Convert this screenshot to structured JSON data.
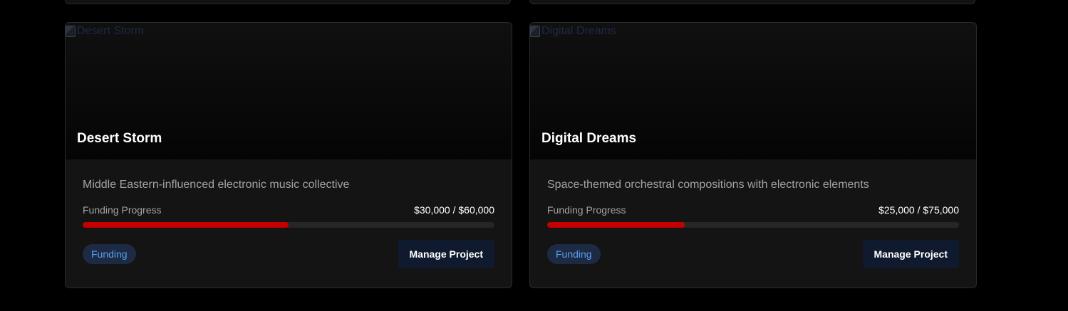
{
  "projects": [
    {
      "image_alt": "Desert Storm",
      "title": "Desert Storm",
      "description": "Middle Eastern-influenced electronic music collective",
      "progress_label": "Funding Progress",
      "progress_amount": "$30,000 / $60,000",
      "progress_fraction": 0.5,
      "status": "Funding",
      "action_label": "Manage Project"
    },
    {
      "image_alt": "Digital Dreams",
      "title": "Digital Dreams",
      "description": "Space-themed orchestral compositions with electronic elements",
      "progress_label": "Funding Progress",
      "progress_amount": "$25,000 / $75,000",
      "progress_fraction": 0.3333,
      "status": "Funding",
      "action_label": "Manage Project"
    }
  ],
  "colors": {
    "progress_fill": "#c40000",
    "badge_text": "#5aa0ef",
    "badge_bg": "#1c2a44",
    "button_bg": "#0f1a2e"
  }
}
